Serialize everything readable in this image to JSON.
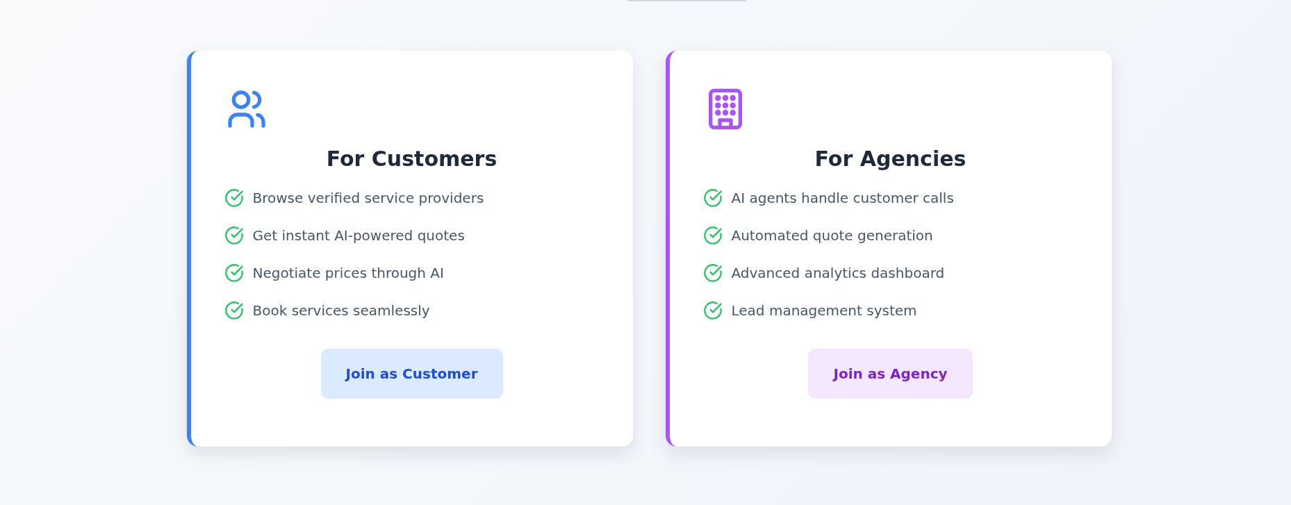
{
  "cards": [
    {
      "kind": "customers",
      "color": "#3b82f6",
      "title": "For Customers",
      "features": [
        "Browse verified service providers",
        "Get instant AI-powered quotes",
        "Negotiate prices through AI",
        "Book services seamlessly"
      ],
      "button": "Join as Customer"
    },
    {
      "kind": "agencies",
      "color": "#a855f7",
      "title": "For Agencies",
      "features": [
        "AI agents handle customer calls",
        "Automated quote generation",
        "Advanced analytics dashboard",
        "Lead management system"
      ],
      "button": "Join as Agency"
    }
  ]
}
